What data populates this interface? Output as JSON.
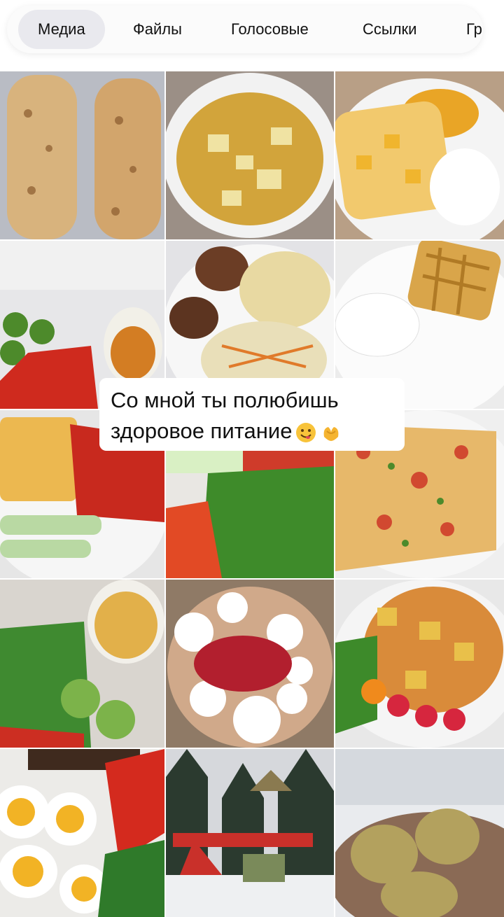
{
  "tabs": [
    {
      "label": "Медиа",
      "active": true
    },
    {
      "label": "Файлы",
      "active": false
    },
    {
      "label": "Голосовые",
      "active": false
    },
    {
      "label": "Ссылки",
      "active": false
    },
    {
      "label": "Гр",
      "active": false
    }
  ],
  "caption": {
    "line1": "Со мной ты полюбишь",
    "line2": "здоровое питание"
  },
  "caption_emojis": [
    "smiling-face-icon",
    "heart-hands-icon"
  ],
  "grid": {
    "photos": [
      "photo-baked-rolls-on-foil",
      "photo-vegetable-soup",
      "photo-toast-with-pumpkin-and-sour-cream",
      "photo-cucumbers-tomatoes-container",
      "photo-cutlets-noodles-salad",
      "photo-waffle-with-yogurt",
      "photo-omelet-with-tomatoes",
      "photo-lettuce-and-vegetables",
      "photo-omelet-with-herbs",
      "photo-salad-with-potatoes",
      "photo-mozzarella-with-berry-sauce",
      "photo-stew-with-radish",
      "photo-eggs-and-pepper",
      "photo-snowy-playground",
      "photo-cheese-buns"
    ]
  }
}
